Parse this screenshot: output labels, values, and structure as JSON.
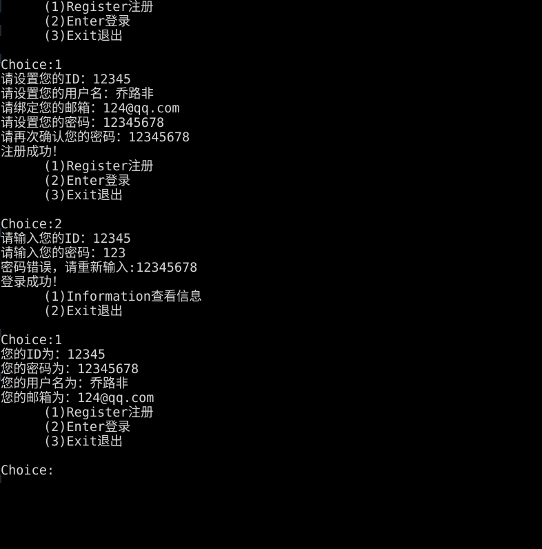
{
  "terminal": {
    "background_color": "#000000",
    "text_color": "#d6d6d6",
    "prompt_label": "Choice:",
    "lines": [
      {
        "text": "        (1)Register注册",
        "indent": true,
        "content": "(1)Register注册"
      },
      {
        "text": "        (2)Enter登录",
        "indent": true,
        "content": "(2)Enter登录"
      },
      {
        "text": "        (3)Exit退出",
        "indent": true,
        "content": "(3)Exit退出"
      },
      {
        "text": "",
        "indent": false,
        "content": ""
      },
      {
        "text": "Choice:1",
        "indent": false,
        "content": "Choice:1"
      },
      {
        "text": "请设置您的ID：12345",
        "indent": false,
        "content": "请设置您的ID：12345"
      },
      {
        "text": "请设置您的用户名：乔路非",
        "indent": false,
        "content": "请设置您的用户名：乔路非"
      },
      {
        "text": "请绑定您的邮箱：124@qq.com",
        "indent": false,
        "content": "请绑定您的邮箱：124@qq.com"
      },
      {
        "text": "请设置您的密码：12345678",
        "indent": false,
        "content": "请设置您的密码：12345678"
      },
      {
        "text": "请再次确认您的密码：12345678",
        "indent": false,
        "content": "请再次确认您的密码：12345678"
      },
      {
        "text": "注册成功！",
        "indent": false,
        "content": "注册成功！"
      },
      {
        "text": "        (1)Register注册",
        "indent": true,
        "content": "(1)Register注册"
      },
      {
        "text": "        (2)Enter登录",
        "indent": true,
        "content": "(2)Enter登录"
      },
      {
        "text": "        (3)Exit退出",
        "indent": true,
        "content": "(3)Exit退出"
      },
      {
        "text": "",
        "indent": false,
        "content": ""
      },
      {
        "text": "Choice:2",
        "indent": false,
        "content": "Choice:2"
      },
      {
        "text": "请输入您的ID：12345",
        "indent": false,
        "content": "请输入您的ID：12345"
      },
      {
        "text": "请输入您的密码：123",
        "indent": false,
        "content": "请输入您的密码：123"
      },
      {
        "text": "密码错误，请重新输入:12345678",
        "indent": false,
        "content": "密码错误，请重新输入:12345678"
      },
      {
        "text": "登录成功！",
        "indent": false,
        "content": "登录成功！"
      },
      {
        "text": "        (1)Information查看信息",
        "indent": true,
        "content": "(1)Information查看信息"
      },
      {
        "text": "        (2)Exit退出",
        "indent": true,
        "content": "(2)Exit退出"
      },
      {
        "text": "",
        "indent": false,
        "content": ""
      },
      {
        "text": "Choice:1",
        "indent": false,
        "content": "Choice:1"
      },
      {
        "text": "您的ID为：12345",
        "indent": false,
        "content": "您的ID为：12345"
      },
      {
        "text": "您的密码为：12345678",
        "indent": false,
        "content": "您的密码为：12345678"
      },
      {
        "text": "您的用户名为：乔路非",
        "indent": false,
        "content": "您的用户名为：乔路非"
      },
      {
        "text": "您的邮箱为：124@qq.com",
        "indent": false,
        "content": "您的邮箱为：124@qq.com"
      },
      {
        "text": "        (1)Register注册",
        "indent": true,
        "content": "(1)Register注册"
      },
      {
        "text": "        (2)Enter登录",
        "indent": true,
        "content": "(2)Enter登录"
      },
      {
        "text": "        (3)Exit退出",
        "indent": true,
        "content": "(3)Exit退出"
      },
      {
        "text": "",
        "indent": false,
        "content": ""
      },
      {
        "text": "Choice:",
        "indent": false,
        "content": "Choice:"
      }
    ],
    "menu_main": {
      "option_1": "(1)Register注册",
      "option_2": "(2)Enter登录",
      "option_3": "(3)Exit退出"
    },
    "menu_logged_in": {
      "option_1": "(1)Information查看信息",
      "option_2": "(2)Exit退出"
    },
    "register_session": {
      "choice": "Choice:1",
      "id_prompt": "请设置您的ID：",
      "id_value": "12345",
      "username_prompt": "请设置您的用户名：",
      "username_value": "乔路非",
      "email_prompt": "请绑定您的邮箱：",
      "email_value": "124@qq.com",
      "password_prompt": "请设置您的密码：",
      "password_value": "12345678",
      "confirm_prompt": "请再次确认您的密码：",
      "confirm_value": "12345678",
      "result": "注册成功！"
    },
    "login_session": {
      "choice": "Choice:2",
      "id_prompt": "请输入您的ID：",
      "id_value": "12345",
      "password_prompt": "请输入您的密码：",
      "password_value": "123",
      "error_prompt": "密码错误，请重新输入:",
      "retry_value": "12345678",
      "result": "登录成功！"
    },
    "information_session": {
      "choice": "Choice:1",
      "id_label": "您的ID为：",
      "id_value": "12345",
      "password_label": "您的密码为：",
      "password_value": "12345678",
      "username_label": "您的用户名为：",
      "username_value": "乔路非",
      "email_label": "您的邮箱为：",
      "email_value": "124@qq.com"
    },
    "final_prompt": "Choice:"
  }
}
